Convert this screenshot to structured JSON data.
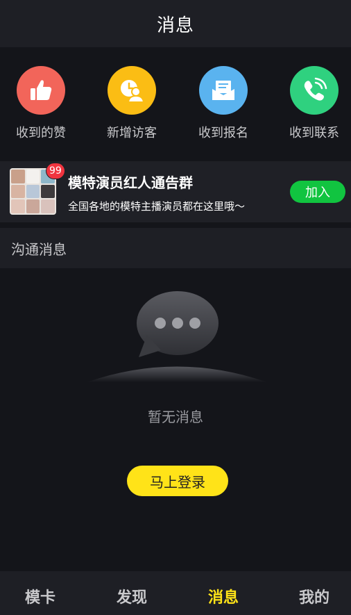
{
  "header": {
    "title": "消息"
  },
  "quick_actions": [
    {
      "label": "收到的赞",
      "icon": "thumbs-up-icon",
      "color": "#f2655a"
    },
    {
      "label": "新增访客",
      "icon": "visitor-clock-icon",
      "color": "#fbbd14"
    },
    {
      "label": "收到报名",
      "icon": "mail-inbox-icon",
      "color": "#5ab3ef"
    },
    {
      "label": "收到联系",
      "icon": "phone-call-icon",
      "color": "#2fd17f"
    }
  ],
  "group_banner": {
    "name": "模特演员红人通告群",
    "description": "全国各地的模特主播演员都在这里哦～",
    "badge": "99",
    "join_label": "加入"
  },
  "section": {
    "title": "沟通消息"
  },
  "empty_state": {
    "text": "暂无消息",
    "login_label": "马上登录"
  },
  "tabbar": {
    "tabs": [
      {
        "label": "模卡",
        "active": false
      },
      {
        "label": "发现",
        "active": false
      },
      {
        "label": "消息",
        "active": true
      },
      {
        "label": "我的",
        "active": false
      }
    ]
  },
  "colors": {
    "accent": "#ffe318",
    "join": "#11c440",
    "badge": "#f1343f",
    "background": "#14151a"
  }
}
